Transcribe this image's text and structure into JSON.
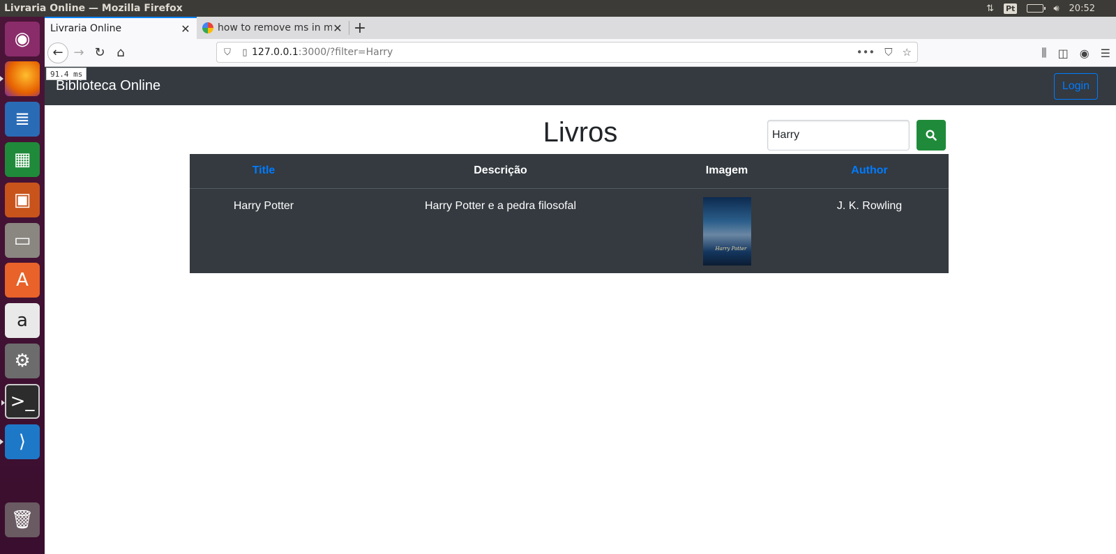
{
  "window": {
    "title": "Livraria Online — Mozilla Firefox"
  },
  "system": {
    "input_indicator": "Pt",
    "clock": "20:52"
  },
  "launcher": {
    "apps": [
      {
        "name": "ubuntu-logo-icon",
        "color": "#8a2c6a"
      },
      {
        "name": "firefox-icon",
        "color": "#e66000"
      },
      {
        "name": "libreoffice-writer-icon",
        "color": "#2a6bb5"
      },
      {
        "name": "libreoffice-calc-icon",
        "color": "#1f8a3a"
      },
      {
        "name": "libreoffice-impress-icon",
        "color": "#c8541c"
      },
      {
        "name": "files-icon",
        "color": "#8a8680"
      },
      {
        "name": "software-center-icon",
        "color": "#e8622a"
      },
      {
        "name": "amazon-icon",
        "color": "#e9e9e9"
      },
      {
        "name": "system-settings-icon",
        "color": "#6c6c6c"
      },
      {
        "name": "terminal-icon",
        "color": "#2c2c2c"
      },
      {
        "name": "vscode-icon",
        "color": "#1e78c8"
      },
      {
        "name": "trash-icon",
        "color": "#6a5a62"
      }
    ]
  },
  "browser": {
    "tabs": [
      {
        "label": "Livraria Online",
        "active": true
      },
      {
        "label": "how to remove ms in mo",
        "active": false
      }
    ],
    "url": {
      "host": "127.0.0.1",
      "rest": ":3000/?filter=Harry"
    },
    "tooltip": "91.4 ms"
  },
  "app": {
    "brand": "Biblioteca Online",
    "login_label": "Login",
    "page_title": "Livros",
    "search": {
      "value": "Harry"
    },
    "table": {
      "headers": {
        "title": "Title",
        "description": "Descrição",
        "image": "Imagem",
        "author": "Author"
      },
      "rows": [
        {
          "title": "Harry Potter",
          "description": "Harry Potter e a pedra filosofal",
          "cover_text": "Harry Potter",
          "author": "J. K. Rowling"
        }
      ]
    }
  },
  "colors": {
    "navbar": "#343a40",
    "link": "#007bff",
    "search_button": "#28a745"
  }
}
